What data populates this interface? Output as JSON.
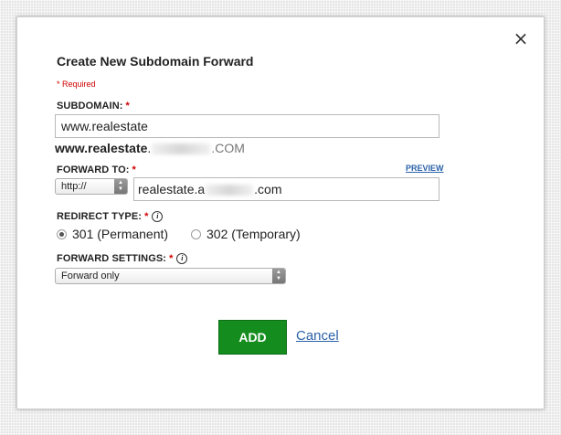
{
  "dialog": {
    "title": "Create New Subdomain Forward",
    "required_note": "* Required",
    "close_glyph": "×"
  },
  "subdomain": {
    "label": "SUBDOMAIN:",
    "required_star": "*",
    "value": "www.realestate",
    "full_preview_prefix": "www.realestate",
    "full_preview_dot": ".",
    "full_preview_suffix": ".COM"
  },
  "forward_to": {
    "label": "FORWARD TO:",
    "required_star": "*",
    "preview_link": "PREVIEW",
    "protocol_selected": "http://",
    "destination_prefix": "realestate.a",
    "destination_suffix": ".com"
  },
  "redirect_type": {
    "label": "REDIRECT TYPE:",
    "required_star": "*",
    "info_icon": "i",
    "options": [
      {
        "label": "301 (Permanent)",
        "checked": true
      },
      {
        "label": "302 (Temporary)",
        "checked": false
      }
    ]
  },
  "forward_settings": {
    "label": "FORWARD SETTINGS:",
    "required_star": "*",
    "info_icon": "i",
    "selected": "Forward only"
  },
  "actions": {
    "add_label": "ADD",
    "cancel_label": "Cancel"
  },
  "colors": {
    "primary_green": "#148c1e",
    "link_blue": "#2a62a8",
    "required_red": "#d00000"
  }
}
